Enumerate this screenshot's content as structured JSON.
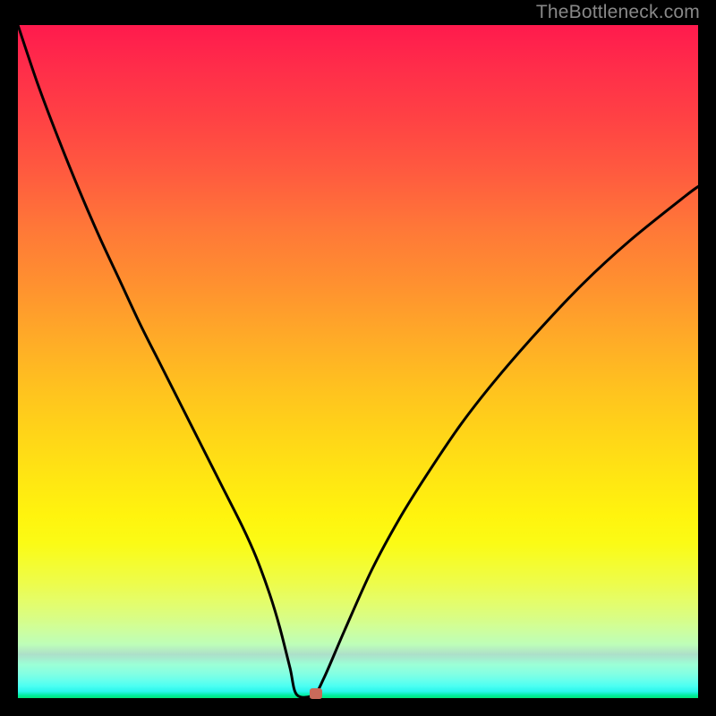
{
  "watermark": "TheBottleneck.com",
  "chart_data": {
    "type": "line",
    "title": "",
    "xlabel": "",
    "ylabel": "",
    "xlim": [
      0,
      100
    ],
    "ylim": [
      0,
      100
    ],
    "grid": false,
    "legend": false,
    "background_gradient": {
      "direction": "vertical",
      "stops": [
        {
          "pos": 0,
          "color": "#ff1a4d"
        },
        {
          "pos": 50,
          "color": "#ffc21f"
        },
        {
          "pos": 80,
          "color": "#f4fc30"
        },
        {
          "pos": 95,
          "color": "#9cffd6"
        },
        {
          "pos": 100,
          "color": "#00e57a"
        }
      ]
    },
    "series": [
      {
        "name": "bottleneck-curve",
        "x": [
          0,
          3,
          6,
          9,
          12,
          15,
          18,
          21,
          24,
          27,
          30,
          33,
          35,
          37,
          38.5,
          40,
          41,
          43.5,
          45,
          48,
          52,
          56,
          60,
          65,
          70,
          76,
          83,
          90,
          98,
          100
        ],
        "y": [
          100,
          91,
          83,
          75.5,
          68.5,
          62,
          55.5,
          49.5,
          43.5,
          37.5,
          31.5,
          25.5,
          21,
          15.5,
          10.5,
          4.5,
          0.5,
          0.5,
          3,
          10,
          19,
          26.5,
          33,
          40.5,
          47,
          54,
          61.5,
          68,
          74.5,
          76
        ]
      }
    ],
    "flat_segment": {
      "x_start": 41,
      "x_end": 43.5,
      "y": 0.5
    },
    "marker": {
      "x": 43.8,
      "y": 0.6,
      "color": "#c96a5a"
    }
  },
  "frame": {
    "border_color": "#000000",
    "bg_color": "#000000"
  }
}
